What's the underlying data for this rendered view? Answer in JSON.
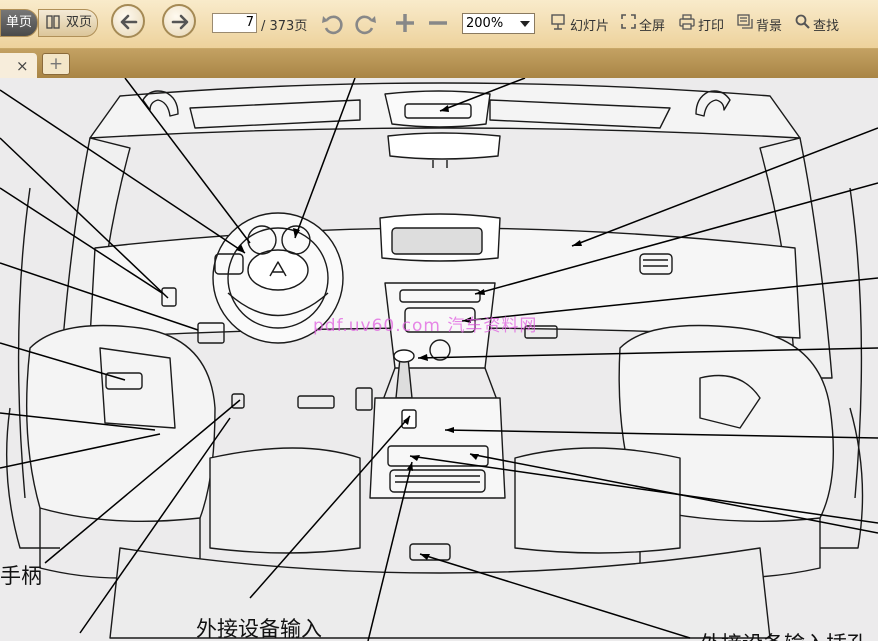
{
  "toolbar": {
    "single_page_label": "单页",
    "double_page_label": "双页",
    "prev_icon": "arrow-left-icon",
    "next_icon": "arrow-right-icon",
    "page_current": "7",
    "page_total_text": "/ 373页",
    "rotate_left_icon": "rotate-left-icon",
    "rotate_right_icon": "rotate-right-icon",
    "zoom_in_icon": "plus-icon",
    "zoom_out_icon": "minus-icon",
    "zoom_value": "200%",
    "slideshow_label": "幻灯片",
    "fullscreen_label": "全屏",
    "print_label": "打印",
    "background_label": "背景",
    "find_label": "查找"
  },
  "tabs": {
    "close_glyph": "×",
    "add_glyph": "+"
  },
  "document": {
    "watermark": "pdf.uv60.com 汽车资料网",
    "callouts": {
      "handle": "手柄",
      "aux_input": "外接设备输入",
      "aux_jack": "外接设备输入插孔"
    }
  },
  "colors": {
    "toolbar_top": "#f9ebcb",
    "toolbar_bottom": "#edd29c",
    "tabbar": "#b8964f",
    "page_bg": "#ecebec",
    "watermark": "#e060e0"
  }
}
